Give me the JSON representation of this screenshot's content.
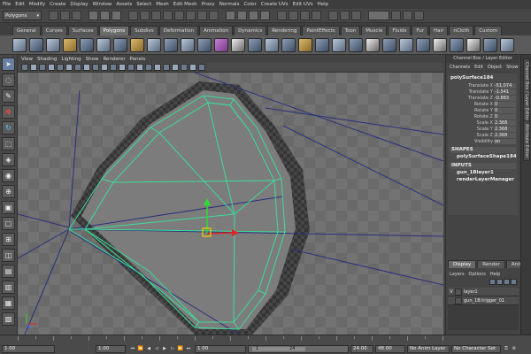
{
  "menubar": {
    "items": [
      "File",
      "Edit",
      "Modify",
      "Create",
      "Display",
      "Window",
      "Assets",
      "Select",
      "Mesh",
      "Edit Mesh",
      "Proxy",
      "Normals",
      "Color",
      "Create UVs",
      "Edit UVs",
      "Help"
    ]
  },
  "statusline": {
    "mode": "Polygons"
  },
  "shelf": {
    "tabs": [
      "General",
      "Curves",
      "Surfaces",
      "Polygons",
      "Subdivs",
      "Deformation",
      "Animation",
      "Dynamics",
      "Rendering",
      "PaintEffects",
      "Toon",
      "Muscle",
      "Fluids",
      "Fur",
      "Hair",
      "nCloth",
      "Custom"
    ],
    "active_tab": "Polygons"
  },
  "viewport": {
    "menu": [
      "View",
      "Shading",
      "Lighting",
      "Show",
      "Renderer",
      "Panels"
    ]
  },
  "channelbox": {
    "title": "Channel Box / Layer Editor",
    "menu": [
      "Channels",
      "Edit",
      "Object",
      "Show"
    ],
    "object_name": "polySurface184",
    "attributes": [
      {
        "label": "Translate X",
        "value": "-51.074"
      },
      {
        "label": "Translate Y",
        "value": "-1.541"
      },
      {
        "label": "Translate Z",
        "value": "-0.883"
      },
      {
        "label": "Rotate X",
        "value": "0"
      },
      {
        "label": "Rotate Y",
        "value": "0"
      },
      {
        "label": "Rotate Z",
        "value": "0"
      },
      {
        "label": "Scale X",
        "value": "2.368"
      },
      {
        "label": "Scale Y",
        "value": "2.368"
      },
      {
        "label": "Scale Z",
        "value": "2.368"
      },
      {
        "label": "Visibility",
        "value": "on"
      }
    ],
    "shapes_header": "SHAPES",
    "shape_name": "polySurfaceShape184",
    "inputs_header": "INPUTS",
    "inputs": [
      "gun_1Blayer1",
      "renderLayerManager"
    ]
  },
  "layer_editor": {
    "tabs": [
      "Display",
      "Render",
      "Anim"
    ],
    "active_tab": "Display",
    "menu": [
      "Layers",
      "Options",
      "Help"
    ],
    "layers": [
      {
        "visibility": "V",
        "name": "layer1"
      },
      {
        "visibility": "",
        "name": "gun_1B:trigger_01"
      }
    ]
  },
  "side_strip": {
    "tab1": "Channel Box / Layer Editor",
    "tab2": "Attribute Editor"
  },
  "timeline": {
    "start_field": "1.00",
    "current_field": "1.00",
    "range_start_field": "1.00",
    "range_start": "1",
    "range_end": "24",
    "end_field": "24.00",
    "anim_end_field": "48.00",
    "anim_layer": "No Anim Layer",
    "character_set": "No Character Set"
  }
}
